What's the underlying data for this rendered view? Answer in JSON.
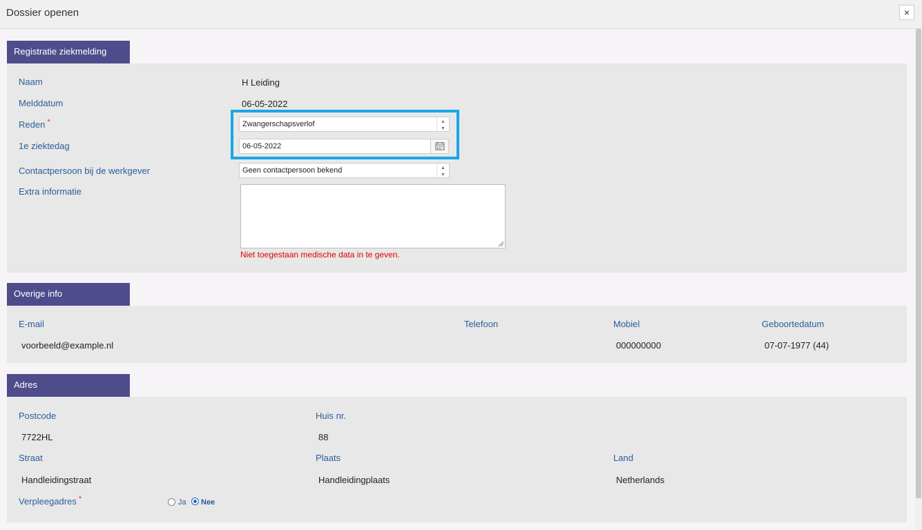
{
  "dialog": {
    "title": "Dossier openen",
    "close_label": "×"
  },
  "registratie": {
    "header": "Registratie ziekmelding",
    "naam": {
      "label": "Naam",
      "value": "H Leiding"
    },
    "melddatum": {
      "label": "Melddatum",
      "value": "06-05-2022"
    },
    "reden": {
      "label": "Reden",
      "required_mark": "*",
      "value": "Zwangerschapsverlof"
    },
    "ziektedag": {
      "label": "1e ziektedag",
      "value": "06-05-2022"
    },
    "contactpersoon": {
      "label": "Contactpersoon bij de werkgever",
      "value": "Geen contactpersoon bekend"
    },
    "extra_informatie": {
      "label": "Extra informatie",
      "value": "",
      "warning": "Niet toegestaan medische data in te geven."
    }
  },
  "overige_info": {
    "header": "Overige info",
    "email": {
      "label": "E-mail",
      "value": "voorbeeld@example.nl"
    },
    "telefoon": {
      "label": "Telefoon",
      "value": ""
    },
    "mobiel": {
      "label": "Mobiel",
      "value": "000000000"
    },
    "geboortedatum": {
      "label": "Geboortedatum",
      "value": "07-07-1977 (44)"
    }
  },
  "adres": {
    "header": "Adres",
    "postcode": {
      "label": "Postcode",
      "value": "7722HL"
    },
    "huisnr": {
      "label": "Huis nr.",
      "value": "88"
    },
    "straat": {
      "label": "Straat",
      "value": "Handleidingstraat"
    },
    "plaats": {
      "label": "Plaats",
      "value": "Handleidingplaats"
    },
    "land": {
      "label": "Land",
      "value": "Netherlands"
    },
    "verpleegadres": {
      "label": "Verpleegadres",
      "required_mark": "*",
      "options": [
        {
          "label": "Ja",
          "selected": false
        },
        {
          "label": "Nee",
          "selected": true
        }
      ]
    }
  },
  "colors": {
    "header_bg": "#4f4c8c",
    "label": "#2a5d9a",
    "highlight": "#1aa6e6",
    "warning": "#e00000"
  }
}
